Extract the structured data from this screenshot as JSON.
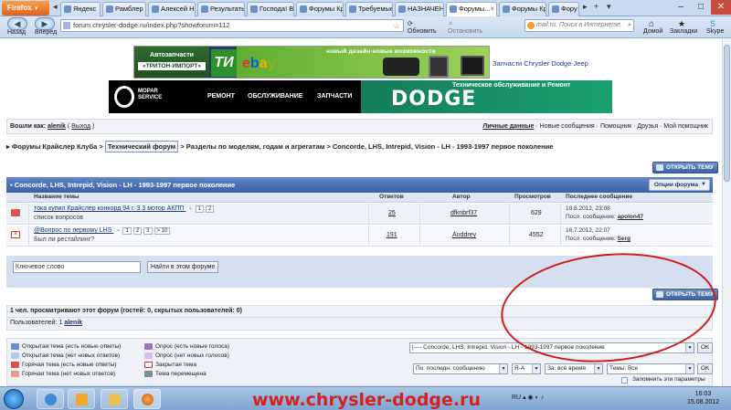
{
  "browser": {
    "app_button": "Firefox",
    "tabs": [
      "Яндекс",
      "Рамблер",
      "Алексей Н...",
      "Результаты...",
      "Господа! В...",
      "Форумы Кр...",
      "Требуемые...",
      "НАЗНАЧЕН...",
      "Форумы...",
      "Форумы Кр...",
      "Фору"
    ],
    "back_label": "Назад",
    "forward_label": "Вперёд",
    "url": "forum.chrysler-dodge.ru/index.php?showforum=112",
    "reload_label": "Обновить",
    "stop_label": "Остановить",
    "search_placeholder": "mail.ru: Поиск в Интернете",
    "home_label": "Домой",
    "bookmarks_label": "Закладки",
    "skype_label": "Skype"
  },
  "banners": {
    "autoparts_title": "Автозапчасти",
    "autoparts_sub": "«ТРИТОН-ИМПОРТ»",
    "tp_logo": "ТИ",
    "ebay_tagline": "новый дизайн-новые возможности",
    "right_text": "Запчасти Chrysler Dodge Jeep",
    "mopar_text": "MOPAR\nSERVICE",
    "link_repair": "РЕМОНТ",
    "link_service": "ОБСЛУЖИВАНИЕ",
    "link_parts": "ЗАПЧАСТИ",
    "dodge": "DODGE",
    "dodge_sub": "Техническое обслуживание и Ремонт"
  },
  "userbar": {
    "logged_as": "Вошли как:",
    "username": "alenik",
    "logout": "Выход",
    "links": [
      "Личные данные",
      "Новые сообщения",
      "Помощник",
      "Друзья",
      "Мой помощник"
    ]
  },
  "breadcrumbs": {
    "b1": "Форумы Крайслер Клуба",
    "b2": "Технический форум",
    "b3": "Разделы по моделям, годам и агрегатам",
    "b4": "Concorde, LHS, Intrepid, Vision - LH - 1993-1997 первое поколение"
  },
  "new_topic_label": "ОТКРЫТЬ ТЕМУ",
  "forum": {
    "title": "Concorde, LHS, Intrepid, Vision - LH - 1993-1997 первое поколение",
    "options_label": "Опции форума",
    "headers": {
      "topic": "Название темы",
      "replies": "Ответов",
      "author": "Автор",
      "views": "Просмотров",
      "last": "Последнее сообщение"
    },
    "rows": [
      {
        "title": "тока купил Крайслер конкорд 94 г. 3.3 мотор АКПП",
        "pages": [
          "1",
          "2"
        ],
        "subtitle": "список вопросов",
        "replies": "25",
        "author": "dfknbrf37",
        "views": "629",
        "last_date": "10.8.2012, 23:08",
        "last_prefix": "Посл. сообщение:",
        "last_author": "apolon47"
      },
      {
        "prefix": "@",
        "title": "Вопрос по первому LHS",
        "pages": [
          "1",
          "2",
          "3",
          "> 10"
        ],
        "subtitle": "Был ли рестайлинг?",
        "replies": "191",
        "author": "Anddrey",
        "views": "4552",
        "last_date": "16.7.2012, 22:07",
        "last_prefix": "Посл. сообщение:",
        "last_author": "Serg"
      }
    ],
    "search_value": "Ключевое слово",
    "search_button": "Найти в этом форуме"
  },
  "viewers": {
    "line1": "1 чел. просматривают этот форум (гостей: 0, скрытых пользователей: 0)",
    "line2_label": "Пользователей: 1",
    "line2_user": "alenik"
  },
  "legend": {
    "items": [
      {
        "label": "Открытая тема (есть новые ответы)",
        "color": "#6c8fd0"
      },
      {
        "label": "Открытая тема (нет новых ответов)",
        "color": "#b8c8e6"
      },
      {
        "label": "Горячая тема (есть новые ответы)",
        "color": "#d9534f"
      },
      {
        "label": "Горячая тема (нет новых ответов)",
        "color": "#e89c95"
      },
      {
        "label": "Опрос (есть новые голоса)",
        "color": "#a06fc4"
      },
      {
        "label": "Опрос (нет новых голосов)",
        "color": "#d6bfe6"
      },
      {
        "label": "Закрытая тема",
        "color": "#c0392b"
      },
      {
        "label": "Тема перемещена",
        "color": "#7f8c8d"
      }
    ],
    "jump_value": "|---- Concorde, LHS, Intrepid, Vision - LH - 1993-1997 первое поколение",
    "ok": "OK",
    "sort_value": "По: последн. сообщению",
    "order_value": "Я-А",
    "time_value": "За: все время",
    "topics_value": "Темы: Все",
    "remember_label": "Запомнить эти параметры"
  },
  "taskbar": {
    "watermark": "www.chrysler-dodge.ru",
    "lang": "RU",
    "time": "16:03",
    "date": "15.08.2012"
  }
}
